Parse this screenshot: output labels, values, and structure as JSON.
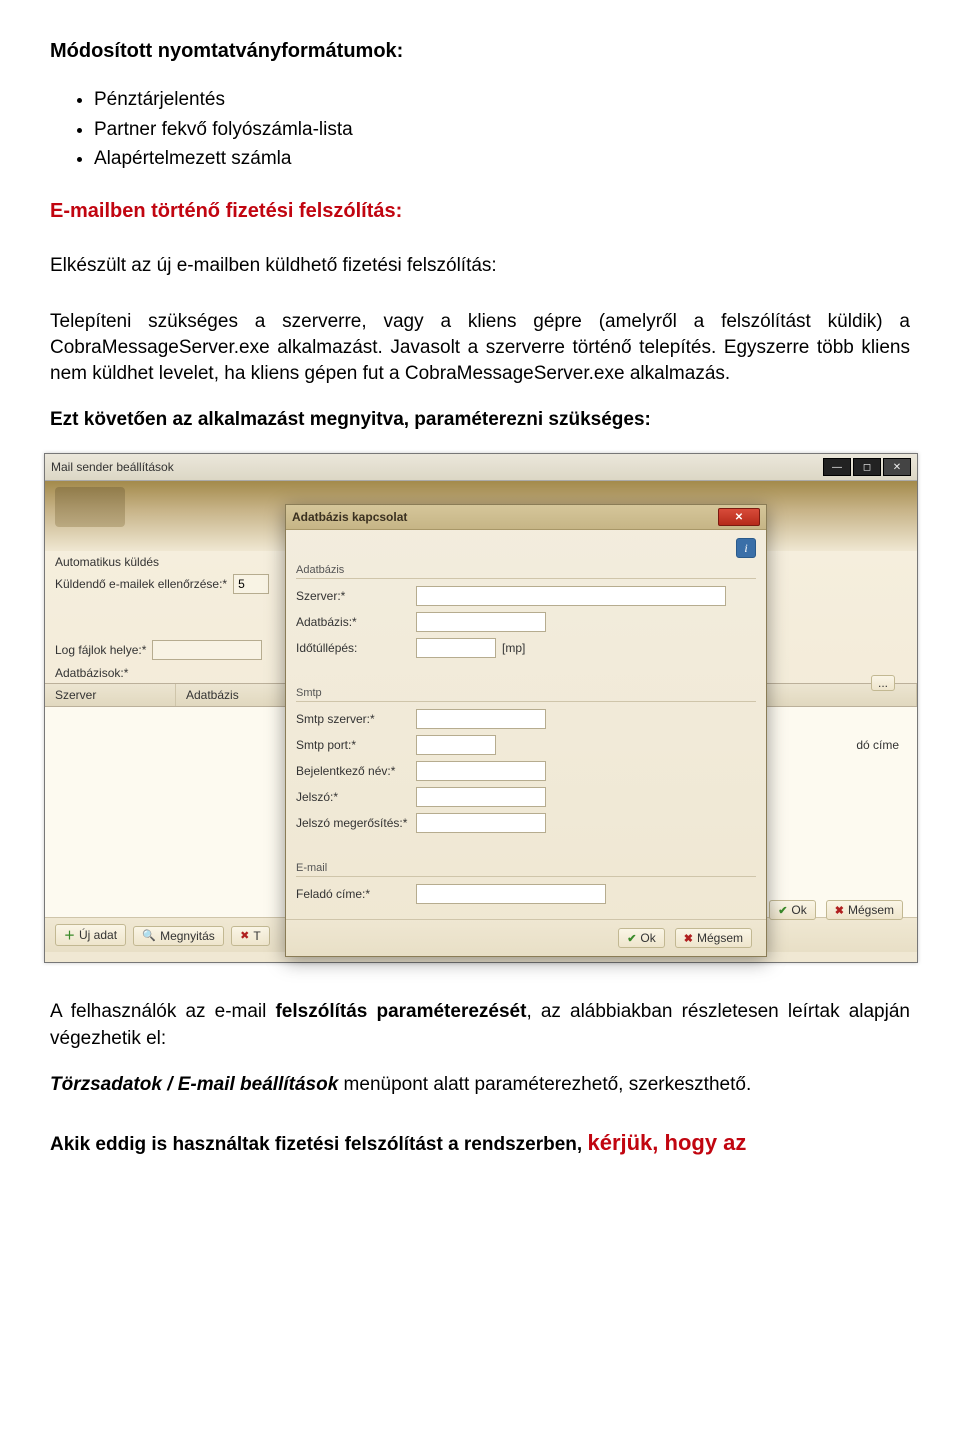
{
  "doc": {
    "heading1": "Módosított nyomtatványformátumok:",
    "bullets": [
      "Pénztárjelentés",
      "Partner fekvő folyószámla-lista",
      "Alapértelmezett számla"
    ],
    "red_heading": "E-mailben történő fizetési felszólítás:",
    "para1": "Elkészült az új e-mailben küldhető fizetési felszólítás:",
    "para2": "Telepíteni szükséges a szerverre, vagy a kliens gépre (amelyről a felszólítást küldik) a CobraMessageServer.exe alkalmazást. Javasolt a szerverre történő telepítés. Egyszerre több kliens nem küldhet levelet, ha kliens gépen fut a CobraMessageServer.exe alkalmazás.",
    "para3": "Ezt követően az alkalmazást megnyitva, paraméterezni szükséges:",
    "para_after1_a": "A felhasználók az e-mail ",
    "para_after1_b": "felszólítás paraméterezését",
    "para_after1_c": ", az alábbiakban részletesen leírtak alapján végezhetik el:",
    "para_after2_a": "Törzsadatok / E-mail beállítások",
    "para_after2_b": " menüpont alatt paraméterezhető, szerkeszthető.",
    "para_after3_a": "Akik eddig is használtak fizetési felszólítást a rendszerben, ",
    "para_after3_b": "kérjük, hogy az"
  },
  "bg": {
    "title": "Mail sender beállítások",
    "section_auto": "Automatikus küldés",
    "check_label": "Küldendő e-mailek ellenőrzése:*",
    "check_value": "5",
    "log_label": "Log fájlok helye:*",
    "dblist_label": "Adatbázisok:*",
    "col_server": "Szerver",
    "col_db": "Adatbázis",
    "right_col": "dó címe",
    "new": "Új adat",
    "open": "Megnyitás",
    "del": "T",
    "ellipsis": "...",
    "ok": "Ok",
    "cancel": "Mégsem"
  },
  "modal": {
    "title": "Adatbázis kapcsolat",
    "info": "i",
    "fs_db": "Adatbázis",
    "lbl_server": "Szerver:*",
    "lbl_db": "Adatbázis:*",
    "lbl_timeout": "Időtúllépés:",
    "timeout_suffix": "[mp]",
    "fs_smtp": "Smtp",
    "lbl_smtp_server": "Smtp szerver:*",
    "lbl_smtp_port": "Smtp port:*",
    "lbl_login": "Bejelentkező név:*",
    "lbl_pw": "Jelszó:*",
    "lbl_pw2": "Jelszó megerősítés:*",
    "fs_email": "E-mail",
    "lbl_sender": "Feladó címe:*",
    "ok": "Ok",
    "cancel": "Mégsem"
  }
}
